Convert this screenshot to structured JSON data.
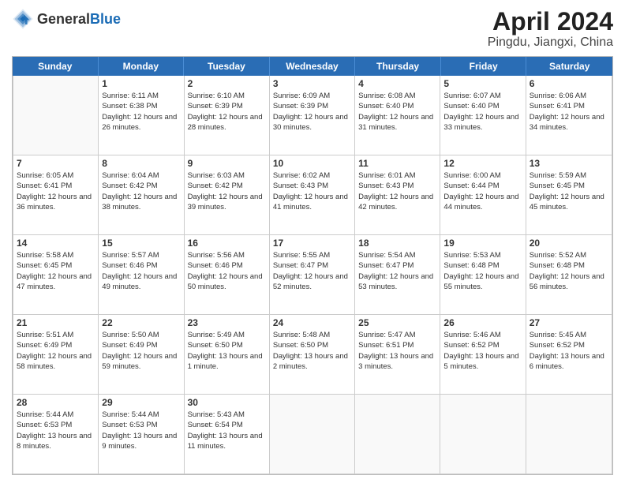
{
  "header": {
    "logo": {
      "general": "General",
      "blue": "Blue"
    },
    "title": "April 2024",
    "location": "Pingdu, Jiangxi, China"
  },
  "weekdays": [
    "Sunday",
    "Monday",
    "Tuesday",
    "Wednesday",
    "Thursday",
    "Friday",
    "Saturday"
  ],
  "weeks": [
    [
      {
        "day": "",
        "empty": true
      },
      {
        "day": "1",
        "sunrise": "6:11 AM",
        "sunset": "6:38 PM",
        "daylight": "12 hours and 26 minutes."
      },
      {
        "day": "2",
        "sunrise": "6:10 AM",
        "sunset": "6:39 PM",
        "daylight": "12 hours and 28 minutes."
      },
      {
        "day": "3",
        "sunrise": "6:09 AM",
        "sunset": "6:39 PM",
        "daylight": "12 hours and 30 minutes."
      },
      {
        "day": "4",
        "sunrise": "6:08 AM",
        "sunset": "6:40 PM",
        "daylight": "12 hours and 31 minutes."
      },
      {
        "day": "5",
        "sunrise": "6:07 AM",
        "sunset": "6:40 PM",
        "daylight": "12 hours and 33 minutes."
      },
      {
        "day": "6",
        "sunrise": "6:06 AM",
        "sunset": "6:41 PM",
        "daylight": "12 hours and 34 minutes."
      }
    ],
    [
      {
        "day": "7",
        "sunrise": "6:05 AM",
        "sunset": "6:41 PM",
        "daylight": "12 hours and 36 minutes."
      },
      {
        "day": "8",
        "sunrise": "6:04 AM",
        "sunset": "6:42 PM",
        "daylight": "12 hours and 38 minutes."
      },
      {
        "day": "9",
        "sunrise": "6:03 AM",
        "sunset": "6:42 PM",
        "daylight": "12 hours and 39 minutes."
      },
      {
        "day": "10",
        "sunrise": "6:02 AM",
        "sunset": "6:43 PM",
        "daylight": "12 hours and 41 minutes."
      },
      {
        "day": "11",
        "sunrise": "6:01 AM",
        "sunset": "6:43 PM",
        "daylight": "12 hours and 42 minutes."
      },
      {
        "day": "12",
        "sunrise": "6:00 AM",
        "sunset": "6:44 PM",
        "daylight": "12 hours and 44 minutes."
      },
      {
        "day": "13",
        "sunrise": "5:59 AM",
        "sunset": "6:45 PM",
        "daylight": "12 hours and 45 minutes."
      }
    ],
    [
      {
        "day": "14",
        "sunrise": "5:58 AM",
        "sunset": "6:45 PM",
        "daylight": "12 hours and 47 minutes."
      },
      {
        "day": "15",
        "sunrise": "5:57 AM",
        "sunset": "6:46 PM",
        "daylight": "12 hours and 49 minutes."
      },
      {
        "day": "16",
        "sunrise": "5:56 AM",
        "sunset": "6:46 PM",
        "daylight": "12 hours and 50 minutes."
      },
      {
        "day": "17",
        "sunrise": "5:55 AM",
        "sunset": "6:47 PM",
        "daylight": "12 hours and 52 minutes."
      },
      {
        "day": "18",
        "sunrise": "5:54 AM",
        "sunset": "6:47 PM",
        "daylight": "12 hours and 53 minutes."
      },
      {
        "day": "19",
        "sunrise": "5:53 AM",
        "sunset": "6:48 PM",
        "daylight": "12 hours and 55 minutes."
      },
      {
        "day": "20",
        "sunrise": "5:52 AM",
        "sunset": "6:48 PM",
        "daylight": "12 hours and 56 minutes."
      }
    ],
    [
      {
        "day": "21",
        "sunrise": "5:51 AM",
        "sunset": "6:49 PM",
        "daylight": "12 hours and 58 minutes."
      },
      {
        "day": "22",
        "sunrise": "5:50 AM",
        "sunset": "6:49 PM",
        "daylight": "12 hours and 59 minutes."
      },
      {
        "day": "23",
        "sunrise": "5:49 AM",
        "sunset": "6:50 PM",
        "daylight": "13 hours and 1 minute."
      },
      {
        "day": "24",
        "sunrise": "5:48 AM",
        "sunset": "6:50 PM",
        "daylight": "13 hours and 2 minutes."
      },
      {
        "day": "25",
        "sunrise": "5:47 AM",
        "sunset": "6:51 PM",
        "daylight": "13 hours and 3 minutes."
      },
      {
        "day": "26",
        "sunrise": "5:46 AM",
        "sunset": "6:52 PM",
        "daylight": "13 hours and 5 minutes."
      },
      {
        "day": "27",
        "sunrise": "5:45 AM",
        "sunset": "6:52 PM",
        "daylight": "13 hours and 6 minutes."
      }
    ],
    [
      {
        "day": "28",
        "sunrise": "5:44 AM",
        "sunset": "6:53 PM",
        "daylight": "13 hours and 8 minutes."
      },
      {
        "day": "29",
        "sunrise": "5:44 AM",
        "sunset": "6:53 PM",
        "daylight": "13 hours and 9 minutes."
      },
      {
        "day": "30",
        "sunrise": "5:43 AM",
        "sunset": "6:54 PM",
        "daylight": "13 hours and 11 minutes."
      },
      {
        "day": "",
        "empty": true
      },
      {
        "day": "",
        "empty": true
      },
      {
        "day": "",
        "empty": true
      },
      {
        "day": "",
        "empty": true
      }
    ]
  ]
}
